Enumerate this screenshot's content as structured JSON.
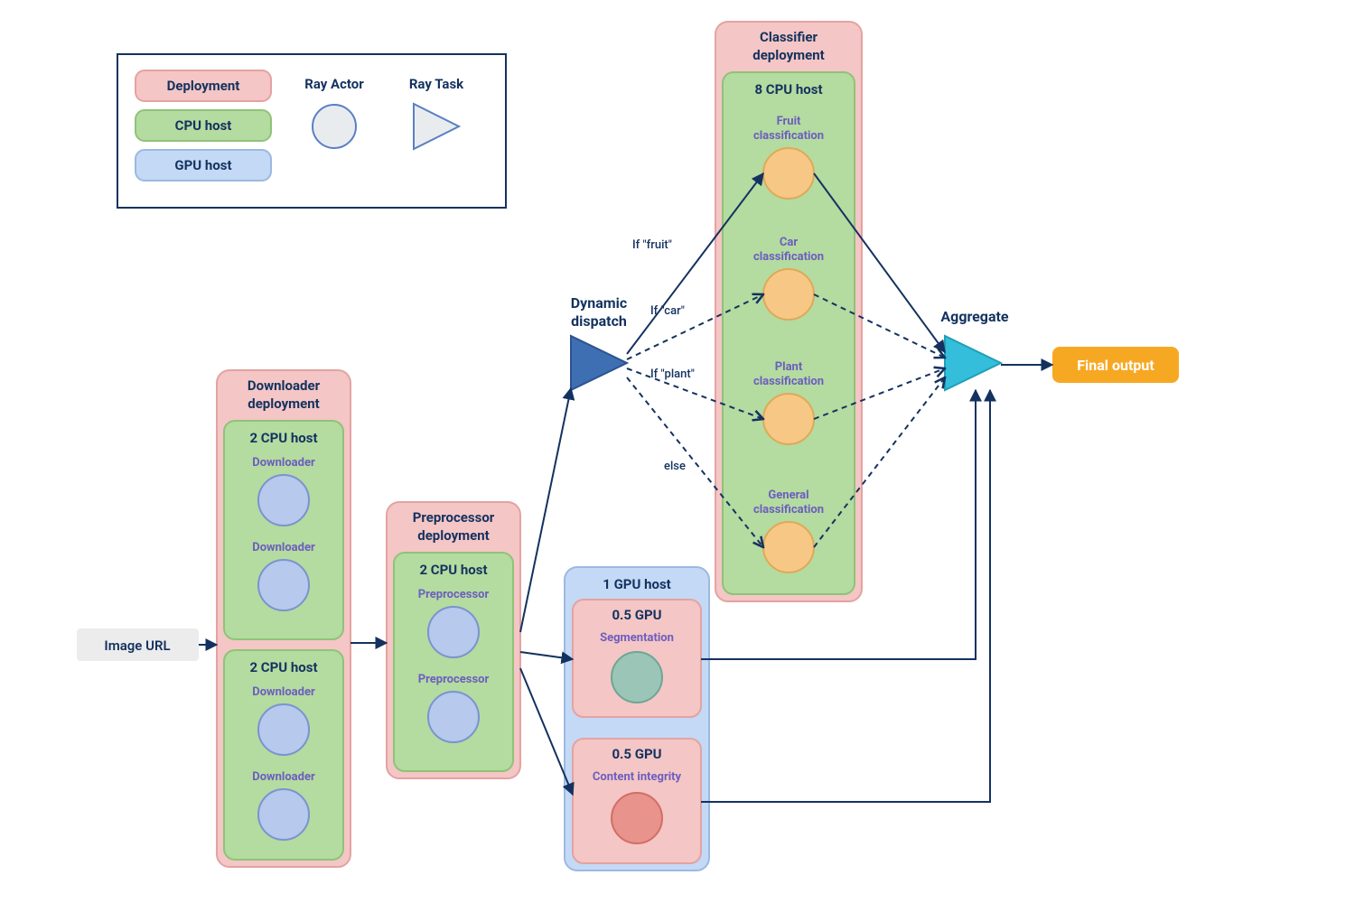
{
  "legend": {
    "deployment": "Deployment",
    "cpu_host": "CPU host",
    "gpu_host": "GPU host",
    "ray_actor": "Ray Actor",
    "ray_task": "Ray Task"
  },
  "input": {
    "label": "Image URL"
  },
  "downloader": {
    "title_line1": "Downloader",
    "title_line2": "deployment",
    "host_label": "2 CPU host",
    "actor_label": "Downloader"
  },
  "preprocessor": {
    "title_line1": "Preprocessor",
    "title_line2": "deployment",
    "host_label": "2 CPU host",
    "actor_label": "Preprocessor"
  },
  "dispatch": {
    "title_line1": "Dynamic",
    "title_line2": "dispatch",
    "branches": {
      "fruit": "If \"fruit\"",
      "car": "If \"car\"",
      "plant": "If \"plant\"",
      "else": "else"
    }
  },
  "classifier": {
    "title_line1": "Classifier",
    "title_line2": "deployment",
    "host_label": "8 CPU host",
    "actors": {
      "fruit_l1": "Fruit",
      "fruit_l2": "classification",
      "car_l1": "Car",
      "car_l2": "classification",
      "plant_l1": "Plant",
      "plant_l2": "classification",
      "general_l1": "General",
      "general_l2": "classification"
    }
  },
  "gpu": {
    "host_label": "1 GPU host",
    "seg_box": "0.5 GPU",
    "seg_label": "Segmentation",
    "ci_box": "0.5 GPU",
    "ci_label": "Content integrity"
  },
  "aggregate": {
    "label": "Aggregate"
  },
  "output": {
    "label": "Final output"
  },
  "colors": {
    "deployment_fill": "#f4c6c5",
    "deployment_stroke": "#e3a3a2",
    "cpu_fill": "#b4dba0",
    "cpu_stroke": "#8fc378",
    "gpu_fill": "#c3d9f5",
    "gpu_stroke": "#9cb9e0",
    "actor_blue_fill": "#b7c9ec",
    "actor_blue_stroke": "#7b93cf",
    "actor_orange_fill": "#f7c885",
    "actor_orange_stroke": "#e0a858",
    "actor_teal_fill": "#9bc5b7",
    "actor_teal_stroke": "#6ea694",
    "actor_red_fill": "#e8938c",
    "actor_red_stroke": "#d26e66",
    "dark_navy": "#14325f",
    "task_blue": "#3e6fb3",
    "task_cyan": "#34bedc",
    "output_orange": "#f7a823",
    "input_gray": "#ececec",
    "legend_task_fill": "#e9ecef"
  }
}
